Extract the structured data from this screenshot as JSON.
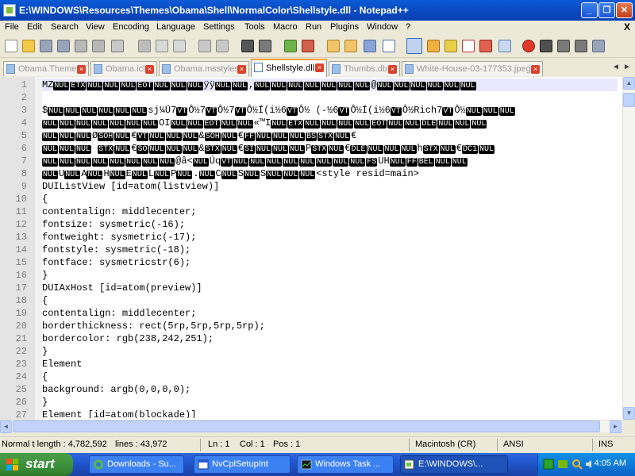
{
  "window": {
    "title": "E:\\WINDOWS\\Resources\\Themes\\Obama\\Shell\\NormalColor\\Shellstyle.dll - Notepad++",
    "minimize": "_",
    "restore": "❐",
    "close": "✕"
  },
  "menu": {
    "items": [
      "File",
      "Edit",
      "Search",
      "View",
      "Encoding",
      "Language",
      "Settings",
      "Tools",
      "Macro",
      "Run",
      "Plugins",
      "Window",
      "?"
    ],
    "close_glyph": "X"
  },
  "toolbar": {
    "icons": [
      "new-file-icon",
      "open-file-icon",
      "save-icon",
      "save-all-icon",
      "close-icon",
      "close-all-icon",
      "print-icon",
      "cut-icon",
      "copy-icon",
      "paste-icon",
      "undo-icon",
      "redo-icon",
      "find-icon",
      "replace-icon",
      "zoom-in-icon",
      "zoom-out-icon",
      "sync-v-icon",
      "sync-h-icon",
      "word-wrap-icon",
      "show-all-chars-icon",
      "indent-guide-icon",
      "user-lang-icon",
      "doc-map-icon",
      "function-list-icon",
      "folder-workspace-icon",
      "monitor-icon",
      "record-macro-icon",
      "stop-record-icon",
      "play-macro-icon",
      "run-macro-multiple-icon",
      "save-macro-icon"
    ]
  },
  "tabs": [
    {
      "label": "Obama.Theme",
      "active": false
    },
    {
      "label": "Obama.icl",
      "active": false
    },
    {
      "label": "Obama.msstyles",
      "active": false
    },
    {
      "label": "Shellstyle.dll",
      "active": true
    },
    {
      "label": "Thumbs.db",
      "active": false
    },
    {
      "label": "White-House-03-177353.jpeg",
      "active": false
    }
  ],
  "editor": {
    "lines": [
      {
        "n": "1",
        "segs": [
          {
            "t": "MZ"
          },
          {
            "k": "NUL"
          },
          {
            "k": "ETX"
          },
          {
            "k": "NUL"
          },
          {
            "k": "NUL"
          },
          {
            "k": "NUL"
          },
          {
            "k": "EOT"
          },
          {
            "k": "NUL"
          },
          {
            "k": "NUL"
          },
          {
            "k": "NUL"
          },
          {
            "t": "ÿÿ"
          },
          {
            "k": "NUL"
          },
          {
            "k": "NUL"
          },
          {
            "t": ","
          },
          {
            "k": "NUL"
          },
          {
            "k": "NUL"
          },
          {
            "k": "NUL"
          },
          {
            "k": "NUL"
          },
          {
            "k": "NUL"
          },
          {
            "k": "NUL"
          },
          {
            "k": "NUL"
          },
          {
            "t": "@"
          },
          {
            "k": "NUL"
          },
          {
            "k": "NUL"
          },
          {
            "k": "NUL"
          },
          {
            "k": "NUL"
          },
          {
            "k": "NUL"
          },
          {
            "k": "NUL"
          }
        ]
      },
      {
        "n": "2",
        "segs": []
      },
      {
        "n": "3",
        "segs": [
          {
            "t": "$"
          },
          {
            "k": "NUL"
          },
          {
            "k": "NUL"
          },
          {
            "k": "NUL"
          },
          {
            "k": "NUL"
          },
          {
            "k": "NUL"
          },
          {
            "k": "NUL"
          },
          {
            "t": "sj¼Ü7"
          },
          {
            "k": "VT"
          },
          {
            "t": "Ô½7"
          },
          {
            "k": "VT"
          },
          {
            "t": "Ô½7"
          },
          {
            "k": "VT"
          },
          {
            "t": "Ô½Í(i½6"
          },
          {
            "k": "VT"
          },
          {
            "t": "Ô½ (-½6"
          },
          {
            "k": "VT"
          },
          {
            "t": "Ô½Í(i½6"
          },
          {
            "k": "VT"
          },
          {
            "t": "Ô½Rich7"
          },
          {
            "k": "VT"
          },
          {
            "t": "Ô½"
          },
          {
            "k": "NUL"
          },
          {
            "k": "NUL"
          },
          {
            "k": "NUL"
          }
        ]
      },
      {
        "n": "4",
        "segs": [
          {
            "k": "NUL"
          },
          {
            "k": "NUL"
          },
          {
            "k": "NUL"
          },
          {
            "k": "NUL"
          },
          {
            "k": "NUL"
          },
          {
            "k": "NUL"
          },
          {
            "k": "NUL"
          },
          {
            "t": "OI"
          },
          {
            "k": "NUL"
          },
          {
            "k": "NUL"
          },
          {
            "k": "EOT"
          },
          {
            "k": "NUL"
          },
          {
            "k": "NUL"
          },
          {
            "t": "«™I"
          },
          {
            "k": "NUL"
          },
          {
            "k": "ETX"
          },
          {
            "k": "NUL"
          },
          {
            "k": "NUL"
          },
          {
            "k": "NUL"
          },
          {
            "k": "NUL"
          },
          {
            "k": "EOT"
          },
          {
            "k": "NUL"
          },
          {
            "k": "NUL"
          },
          {
            "k": "DLE"
          },
          {
            "k": "NUL"
          },
          {
            "k": "NUL"
          },
          {
            "k": "NUL"
          }
        ]
      },
      {
        "n": "5",
        "segs": [
          {
            "k": "NUL"
          },
          {
            "k": "NUL"
          },
          {
            "k": "NUL"
          },
          {
            "t": "Ø"
          },
          {
            "k": "SOH"
          },
          {
            "k": "NUL"
          },
          {
            "t": "€"
          },
          {
            "k": "VT"
          },
          {
            "k": "NUL"
          },
          {
            "k": "NUL"
          },
          {
            "k": "NUL"
          },
          {
            "t": "&"
          },
          {
            "k": "SOH"
          },
          {
            "k": "NUL"
          },
          {
            "t": "€"
          },
          {
            "k": "FF"
          },
          {
            "k": "NUL"
          },
          {
            "k": "NUL"
          },
          {
            "k": "NUL"
          },
          {
            "k": "BS"
          },
          {
            "k": "STX"
          },
          {
            "k": "NUL"
          },
          {
            "t": "€"
          }
        ]
      },
      {
        "n": "6",
        "segs": [
          {
            "k": "NUL"
          },
          {
            "k": "NUL"
          },
          {
            "k": "NUL"
          },
          {
            "t": " "
          },
          {
            "k": "STX"
          },
          {
            "k": "NUL"
          },
          {
            "t": "€"
          },
          {
            "k": "SO"
          },
          {
            "k": "NUL"
          },
          {
            "k": "NUL"
          },
          {
            "k": "NUL"
          },
          {
            "t": "&"
          },
          {
            "k": "STX"
          },
          {
            "k": "NUL"
          },
          {
            "t": "€"
          },
          {
            "k": "SI"
          },
          {
            "k": "NUL"
          },
          {
            "k": "NUL"
          },
          {
            "k": "NUL"
          },
          {
            "t": "P"
          },
          {
            "k": "STX"
          },
          {
            "k": "NUL"
          },
          {
            "t": "€"
          },
          {
            "k": "DLE"
          },
          {
            "k": "NUL"
          },
          {
            "k": "NUL"
          },
          {
            "k": "NUL"
          },
          {
            "t": "h"
          },
          {
            "k": "STX"
          },
          {
            "k": "NUL"
          },
          {
            "t": "€"
          },
          {
            "k": "DC1"
          },
          {
            "k": "NUL"
          }
        ]
      },
      {
        "n": "7",
        "segs": [
          {
            "k": "NUL"
          },
          {
            "k": "NUL"
          },
          {
            "k": "NUL"
          },
          {
            "k": "NUL"
          },
          {
            "k": "NUL"
          },
          {
            "k": "NUL"
          },
          {
            "k": "NUL"
          },
          {
            "k": "NUL"
          },
          {
            "t": "@â<"
          },
          {
            "k": "NUL"
          },
          {
            "t": "Úq"
          },
          {
            "k": "VT"
          },
          {
            "k": "NUL"
          },
          {
            "k": "NUL"
          },
          {
            "k": "NUL"
          },
          {
            "k": "NUL"
          },
          {
            "k": "NUL"
          },
          {
            "k": "NUL"
          },
          {
            "k": "NUL"
          },
          {
            "k": "NUL"
          },
          {
            "k": "FS"
          },
          {
            "t": "UH"
          },
          {
            "k": "NUL"
          },
          {
            "k": "FF"
          },
          {
            "k": "BEL"
          },
          {
            "k": "NUL"
          },
          {
            "k": "NUL"
          }
        ]
      },
      {
        "n": "8",
        "segs": [
          {
            "k": "NUL"
          },
          {
            "t": "U"
          },
          {
            "k": "NUL"
          },
          {
            "t": "A"
          },
          {
            "k": "NUL"
          },
          {
            "t": "H"
          },
          {
            "k": "NUL"
          },
          {
            "t": "E"
          },
          {
            "k": "NUL"
          },
          {
            "t": "L"
          },
          {
            "k": "NUL"
          },
          {
            "t": "P"
          },
          {
            "k": "NUL"
          },
          {
            "t": "."
          },
          {
            "k": "NUL"
          },
          {
            "t": "C"
          },
          {
            "k": "NUL"
          },
          {
            "t": "S"
          },
          {
            "k": "NUL"
          },
          {
            "t": "S"
          },
          {
            "k": "NUL"
          },
          {
            "k": "NUL"
          },
          {
            "k": "NUL"
          },
          {
            "t": "<style resid=main>"
          }
        ]
      },
      {
        "n": "9",
        "segs": [
          {
            "t": "DUIListView [id=atom(listview)]"
          }
        ]
      },
      {
        "n": "10",
        "segs": [
          {
            "t": "{"
          }
        ]
      },
      {
        "n": "11",
        "segs": [
          {
            "t": "contentalign: middlecenter;"
          }
        ]
      },
      {
        "n": "12",
        "segs": [
          {
            "t": "fontsize: sysmetric(-16);"
          }
        ]
      },
      {
        "n": "13",
        "segs": [
          {
            "t": "fontweight: sysmetric(-17);"
          }
        ]
      },
      {
        "n": "14",
        "segs": [
          {
            "t": "fontstyle: sysmetric(-18);"
          }
        ]
      },
      {
        "n": "15",
        "segs": [
          {
            "t": "fontface: sysmetricstr(6);"
          }
        ]
      },
      {
        "n": "16",
        "segs": [
          {
            "t": "}"
          }
        ]
      },
      {
        "n": "17",
        "segs": [
          {
            "t": "DUIAxHost [id=atom(preview)]"
          }
        ]
      },
      {
        "n": "18",
        "segs": [
          {
            "t": "{"
          }
        ]
      },
      {
        "n": "19",
        "segs": [
          {
            "t": "contentalign: middlecenter;"
          }
        ]
      },
      {
        "n": "20",
        "segs": [
          {
            "t": "borderthickness: rect(5rp,5rp,5rp,5rp);"
          }
        ]
      },
      {
        "n": "21",
        "segs": [
          {
            "t": "bordercolor: rgb(238,242,251);"
          }
        ]
      },
      {
        "n": "22",
        "segs": [
          {
            "t": "}"
          }
        ]
      },
      {
        "n": "23",
        "segs": [
          {
            "t": "Element"
          }
        ]
      },
      {
        "n": "24",
        "segs": [
          {
            "t": "{"
          }
        ]
      },
      {
        "n": "25",
        "segs": [
          {
            "t": "background: argb(0,0,0,0);"
          }
        ]
      },
      {
        "n": "26",
        "segs": [
          {
            "t": "}"
          }
        ]
      },
      {
        "n": "27",
        "segs": [
          {
            "t": "Element [id=atom(blockade)]"
          }
        ]
      }
    ]
  },
  "status": {
    "length": "Normal t length : 4,782,592",
    "lines": "lines : 43,972",
    "ln": "Ln : 1",
    "col": "Col : 1",
    "pos": "Pos : 1",
    "eol": "Macintosh (CR)",
    "encoding": "ANSI",
    "mode": "INS"
  },
  "taskbar": {
    "start": "start",
    "tasks": [
      {
        "label": "Downloads - Su...",
        "active": false
      },
      {
        "label": "NvCplSetupInt",
        "active": false
      },
      {
        "label": "Windows Task ...",
        "active": false
      },
      {
        "label": "E:\\WINDOWS\\...",
        "active": true
      }
    ],
    "clock": "4:05 AM"
  },
  "colors": {
    "titlebar": "#0a4dc6",
    "active_tab_accent": "#fba33b",
    "control_char_bg": "#000000",
    "current_line": "#e8e8ff"
  }
}
